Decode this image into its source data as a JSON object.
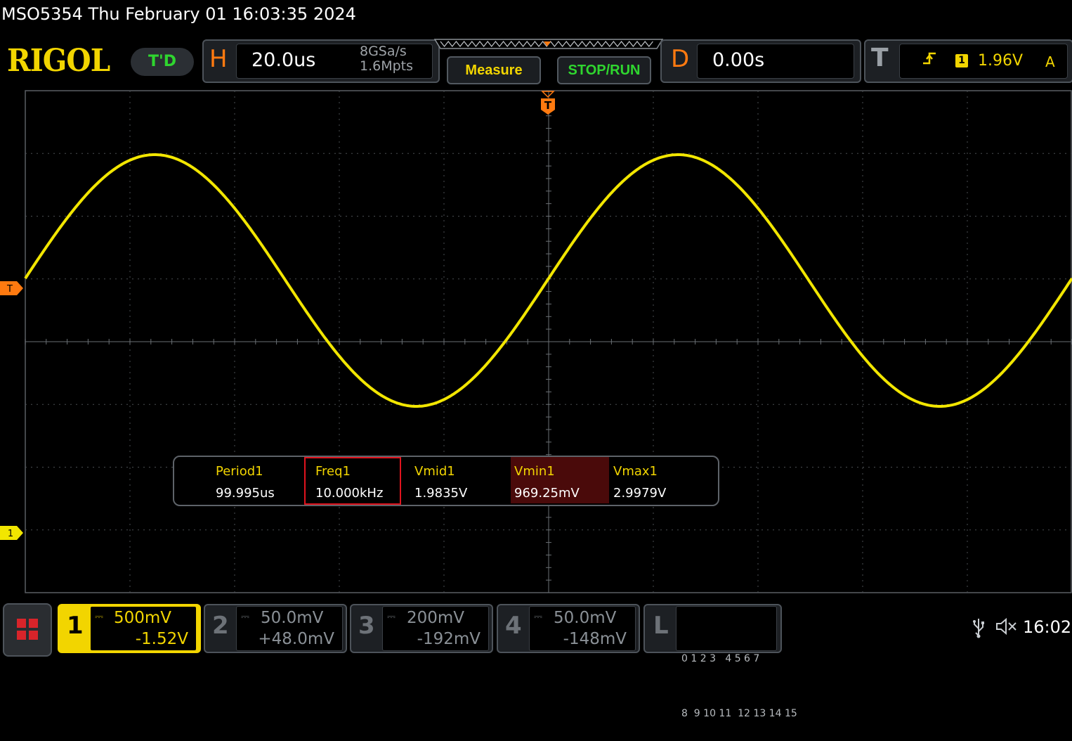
{
  "title_bar": {
    "text": "MSO5354  Thu February 01 16:03:35 2024"
  },
  "logo": {
    "text": "RIGOL"
  },
  "td_mode": {
    "label": "T'D"
  },
  "horizontal": {
    "letter": "H",
    "timebase": "20.0us",
    "sample_rate": "8GSa/s",
    "memory_depth": "1.6Mpts"
  },
  "buttons": {
    "measure": "Measure",
    "stop_run": "STOP/RUN"
  },
  "delay": {
    "letter": "D",
    "value": "0.00s"
  },
  "trigger": {
    "letter": "T",
    "edge_icon": "rising-edge-icon",
    "source": "1",
    "level": "1.96V",
    "mode": "A"
  },
  "markers": {
    "trigger_position": "T",
    "trigger_level": "T",
    "channel1": "1"
  },
  "waveform": {
    "channel": 1,
    "color": "#f2e600",
    "shape": "sine",
    "frequency_hz": 10000,
    "vmax_v": 2.9979,
    "vmin_v": 0.96925
  },
  "measurements": [
    {
      "label": "Period1",
      "value": "99.995us"
    },
    {
      "label": "Freq1",
      "value": "10.000kHz",
      "highlighted": true
    },
    {
      "label": "Vmid1",
      "value": "1.9835V"
    },
    {
      "label": "Vmin1",
      "value": "969.25mV",
      "selected": true
    },
    {
      "label": "Vmax1",
      "value": "2.9979V"
    }
  ],
  "channels": [
    {
      "num": "1",
      "scale": "500mV",
      "offset": "-1.52V",
      "coupling": "DC",
      "active": true,
      "color": "#f2d500"
    },
    {
      "num": "2",
      "scale": "50.0mV",
      "offset": "+48.0mV",
      "coupling": "DC",
      "active": false
    },
    {
      "num": "3",
      "scale": "200mV",
      "offset": "-192mV",
      "coupling": "DC",
      "active": false
    },
    {
      "num": "4",
      "scale": "50.0mV",
      "offset": "-148mV",
      "coupling": "DC",
      "active": false
    }
  ],
  "logic": {
    "letter": "L",
    "row1": "0 1 2 3   4 5 6 7",
    "row2": "8  9 10 11  12 13 14 15"
  },
  "status": {
    "usb_icon": "usb-icon",
    "sound_icon": "speaker-muted-icon",
    "clock": "16:02"
  },
  "colors": {
    "accent_orange": "#ff7a10",
    "channel1_yellow": "#f2d500",
    "run_green": "#2fd62f",
    "highlight_red": "#e0141e"
  }
}
